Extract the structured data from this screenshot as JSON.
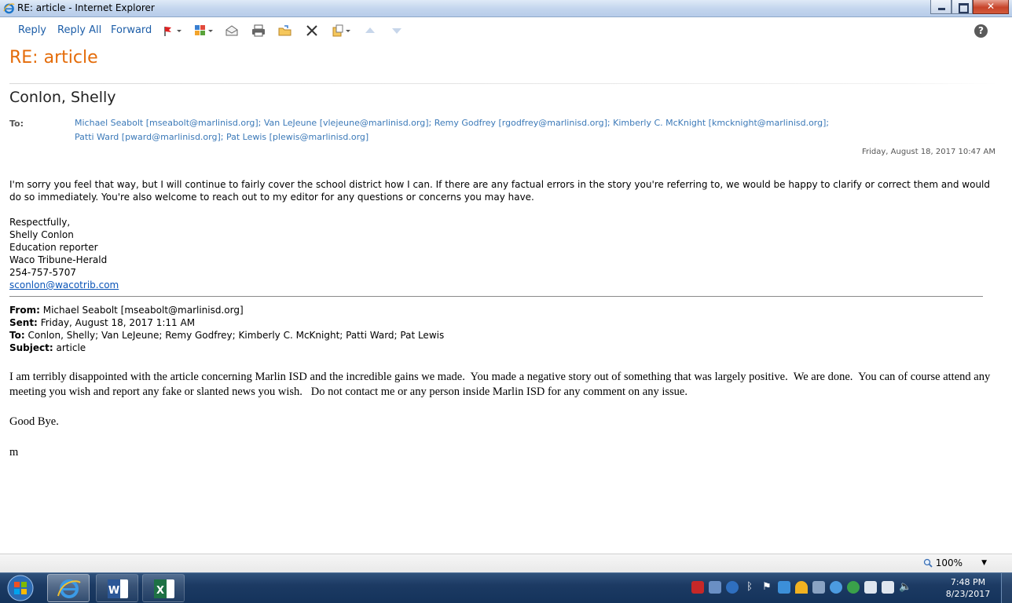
{
  "window": {
    "title": "RE: article - Internet Explorer"
  },
  "toolbar": {
    "reply": "Reply",
    "reply_all": "Reply All",
    "forward": "Forward",
    "help": "?"
  },
  "message": {
    "subject": "RE: article",
    "sender": "Conlon, Shelly",
    "to_label": "To:",
    "to_line1": "Michael Seabolt [mseabolt@marlinisd.org]; Van LeJeune [vlejeune@marlinisd.org]; Remy Godfrey [rgodfrey@marlinisd.org]; Kimberly C. McKnight [kmcknight@marlinisd.org];",
    "to_line2": "Patti Ward [pward@marlinisd.org]; Pat Lewis [plewis@marlinisd.org]",
    "date": "Friday, August 18, 2017 10:47 AM",
    "body": "I'm sorry you feel that way, but I will continue to fairly cover the school district how I can. If there are any factual errors in the story you're referring to, we would be happy to clarify or correct them and would do so immediately. You're also welcome to reach out to my editor for any questions or concerns you may have.",
    "signature": {
      "closing": "Respectfully,",
      "name": "Shelly Conlon",
      "role": "Education reporter",
      "org": "Waco Tribune-Herald",
      "phone": "254-757-5707",
      "email": "sconlon@wacotrib.com"
    },
    "quoted": {
      "from_label": "From:",
      "from": "Michael Seabolt [mseabolt@marlinisd.org]",
      "sent_label": "Sent:",
      "sent": "Friday, August 18, 2017 1:11 AM",
      "to_label": "To:",
      "to": "Conlon, Shelly; Van LeJeune; Remy Godfrey; Kimberly C. McKnight; Patti Ward; Pat Lewis",
      "subject_label": "Subject:",
      "subject": "article",
      "body": "I am terribly disappointed with the article concerning Marlin ISD and the incredible gains we made.  You made a negative story out of something that was largely positive.  We are done.  You can of course attend any meeting you wish and report any fake or slanted news you wish.   Do not contact me or any person inside Marlin ISD for any comment on any issue.",
      "closing": "Good Bye.",
      "initial": "m"
    }
  },
  "statusbar": {
    "zoom": "100%"
  },
  "taskbar": {
    "time": "7:48 PM",
    "date": "8/23/2017"
  },
  "colors": {
    "subject": "#e46c0a",
    "link": "#1d5ea8",
    "recipients": "#3b79b8",
    "taskbar": "#1c3a63"
  }
}
